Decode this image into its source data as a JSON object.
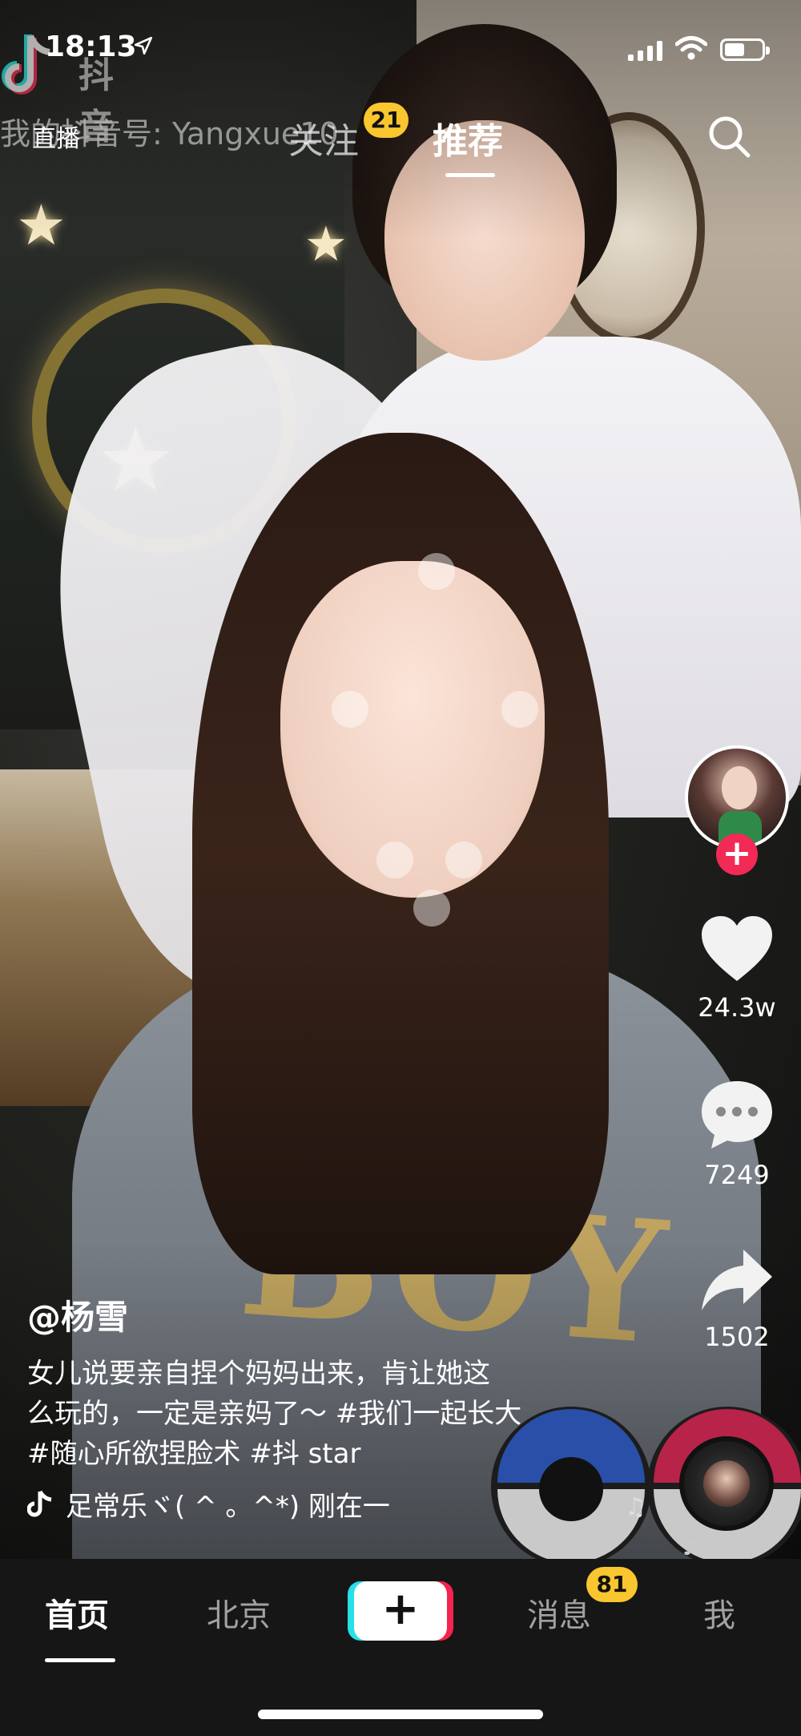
{
  "status_bar": {
    "time": "18:13",
    "battery_level": 0.55
  },
  "watermark": {
    "app_name": "抖音",
    "account_id": "我的抖音号: Yangxue10"
  },
  "top_nav": {
    "live_label": "直播",
    "tabs": [
      {
        "label": "关注",
        "badge": "21"
      },
      {
        "label": "推荐"
      }
    ],
    "active_tab": "推荐",
    "search_icon": "search-icon"
  },
  "sidebar": {
    "follow_icon": "plus-icon",
    "like_count": "24.3w",
    "comment_count": "7249",
    "share_count": "1502"
  },
  "caption": {
    "author": "@杨雪",
    "description_line1": "女儿说要亲自捏个妈妈出来，肯让她这",
    "description_line2": "么玩的，一定是亲妈了～ #我们一起长大",
    "description_line3": "#随心所欲捏脸术 #抖 star",
    "music": "足常乐ヾ( ^ 。^*)    刚在一"
  },
  "video_overlay_text": "BOY",
  "bottom_nav": {
    "items": [
      {
        "label": "首页"
      },
      {
        "label": "北京"
      },
      {
        "label": "+"
      },
      {
        "label": "消息",
        "badge": "81"
      },
      {
        "label": "我"
      }
    ],
    "active": "首页"
  },
  "colors": {
    "accent_red": "#f22a55",
    "badge_yellow": "#f9c62f",
    "nav_bg": "#161616"
  }
}
